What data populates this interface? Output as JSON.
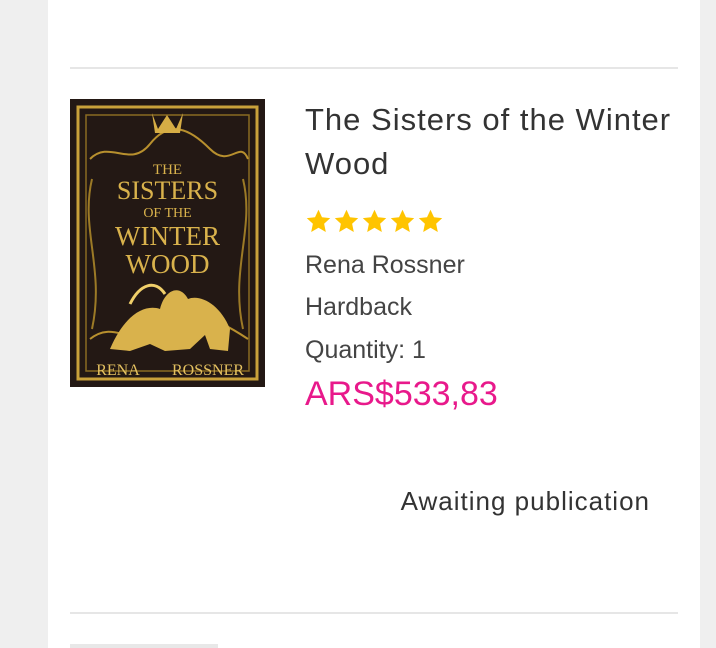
{
  "product": {
    "title": "The Sisters of the Winter Wood",
    "rating": 5,
    "rating_max": 5,
    "author": "Rena Rossner",
    "format": "Hardback",
    "quantity_label": "Quantity: 1",
    "price": "ARS$533,83",
    "status": "Awaiting publication",
    "cover": {
      "line1": "THE",
      "line2": "SISTERS",
      "line3": "OF THE",
      "line4": "WINTER",
      "line5": "WOOD",
      "author_first": "RENA",
      "author_last": "ROSSNER"
    }
  },
  "colors": {
    "price": "#e8198b",
    "star": "#ffc400",
    "cover_bg": "#231814",
    "cover_gold": "#c9a13a"
  }
}
